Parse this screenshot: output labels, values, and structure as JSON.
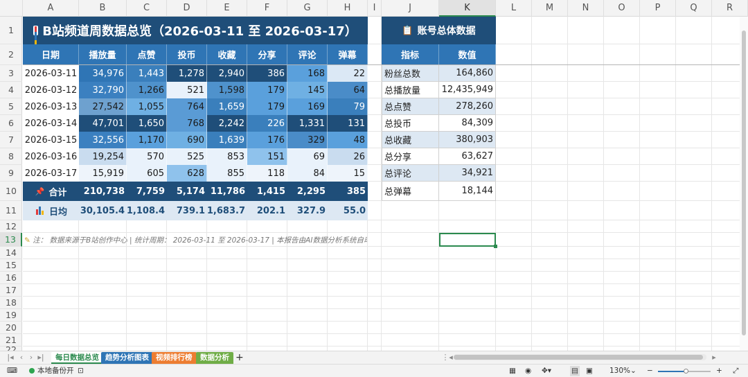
{
  "sheet": {
    "columns": [
      "A",
      "B",
      "C",
      "D",
      "E",
      "F",
      "G",
      "H",
      "I",
      "J",
      "K",
      "L",
      "M",
      "N",
      "O",
      "P",
      "Q",
      "R"
    ],
    "rows": [
      "1",
      "2",
      "3",
      "4",
      "5",
      "6",
      "7",
      "8",
      "9",
      "10",
      "11",
      "12",
      "13",
      "14",
      "15",
      "16",
      "17",
      "18",
      "19",
      "20",
      "21",
      "22"
    ],
    "active_column": "K",
    "active_row": "13"
  },
  "report": {
    "title": "B站频道周数据总览（2026-03-11 至 2026-03-17）",
    "title_icon": "bar-chart-icon",
    "headers": [
      "日期",
      "播放量",
      "点赞",
      "投币",
      "收藏",
      "分享",
      "评论",
      "弹幕"
    ],
    "rows": [
      {
        "date": "2026-03-11",
        "values": [
          "34,976",
          "1,443",
          "1,278",
          "2,940",
          "386",
          "168",
          "22"
        ]
      },
      {
        "date": "2026-03-12",
        "values": [
          "32,790",
          "1,266",
          "521",
          "1,598",
          "179",
          "145",
          "64"
        ]
      },
      {
        "date": "2026-03-13",
        "values": [
          "27,542",
          "1,055",
          "764",
          "1,659",
          "179",
          "169",
          "79"
        ]
      },
      {
        "date": "2026-03-14",
        "values": [
          "47,701",
          "1,650",
          "768",
          "2,242",
          "226",
          "1,331",
          "131"
        ]
      },
      {
        "date": "2026-03-15",
        "values": [
          "32,556",
          "1,170",
          "690",
          "1,639",
          "176",
          "329",
          "48"
        ]
      },
      {
        "date": "2026-03-16",
        "values": [
          "19,254",
          "570",
          "525",
          "853",
          "151",
          "69",
          "26"
        ]
      },
      {
        "date": "2026-03-17",
        "values": [
          "15,919",
          "605",
          "628",
          "855",
          "118",
          "84",
          "15"
        ]
      }
    ],
    "heat_colors": [
      [
        "#2f75b5",
        "#3a7fbc",
        "#1f4e79",
        "#1f4e79",
        "#1f4e79",
        "#5aa0dc",
        "#dbe8f5"
      ],
      [
        "#3b80c0",
        "#4f92cc",
        "#e9f2fb",
        "#4f92cc",
        "#5aa0dc",
        "#6fb0e3",
        "#4a8cc8"
      ],
      [
        "#6ea1cf",
        "#6fb0e3",
        "#5a9bd5",
        "#3a7fbc",
        "#5aa0dc",
        "#5aa0dc",
        "#3a7fbc"
      ],
      [
        "#1f4e79",
        "#1f4e79",
        "#5a9bd5",
        "#1f4e79",
        "#3a7fbc",
        "#1f4e79",
        "#1f4e79"
      ],
      [
        "#3b80c0",
        "#5aa0dc",
        "#6fb0e3",
        "#3a7fbc",
        "#5aa0dc",
        "#4a8cc8",
        "#5aa0dc"
      ],
      [
        "#c9dcef",
        "#e9f2fb",
        "#e9f2fb",
        "#e9f2fb",
        "#8fc2ec",
        "#e9f2fb",
        "#c9dcef"
      ],
      [
        "#eef4fb",
        "#e9f2fb",
        "#8fc2ec",
        "#e9f2fb",
        "#eef4fb",
        "#e9f2fb",
        "#eef4fb"
      ]
    ],
    "total": {
      "label": "合计",
      "icon": "pin-icon",
      "values": [
        "210,738",
        "7,759",
        "5,174",
        "11,786",
        "1,415",
        "2,295",
        "385"
      ]
    },
    "average": {
      "label": "日均",
      "icon": "bar-chart-icon",
      "values": [
        "30,105.4",
        "1,108.4",
        "739.1",
        "1,683.7",
        "202.1",
        "327.9",
        "55.0"
      ]
    },
    "note": "注： 数据来源于B站创作中心 | 统计周期： 2026-03-11 至 2026-03-17 | 本报告由AI数据分析系统自动生成"
  },
  "account": {
    "title": "账号总体数据",
    "title_icon": "clipboard-icon",
    "headers": [
      "指标",
      "数值"
    ],
    "rows": [
      {
        "metric": "粉丝总数",
        "value": "164,860"
      },
      {
        "metric": "总播放量",
        "value": "12,435,949"
      },
      {
        "metric": "总点赞",
        "value": "278,260"
      },
      {
        "metric": "总投币",
        "value": "84,309"
      },
      {
        "metric": "总收藏",
        "value": "380,903"
      },
      {
        "metric": "总分享",
        "value": "63,627"
      },
      {
        "metric": "总评论",
        "value": "34,921"
      },
      {
        "metric": "总弹幕",
        "value": "18,144"
      }
    ]
  },
  "tabs": [
    {
      "label": "每日数据总览",
      "color": "#ffffff",
      "active": true
    },
    {
      "label": "趋势分析图表",
      "color": "#2f75b5",
      "active": false
    },
    {
      "label": "视频排行榜",
      "color": "#ed7d31",
      "active": false
    },
    {
      "label": "数据分析",
      "color": "#70ad47",
      "active": false
    }
  ],
  "status": {
    "backup": "本地备份开",
    "zoom": "130%",
    "zoom_fraction": 0.52
  }
}
